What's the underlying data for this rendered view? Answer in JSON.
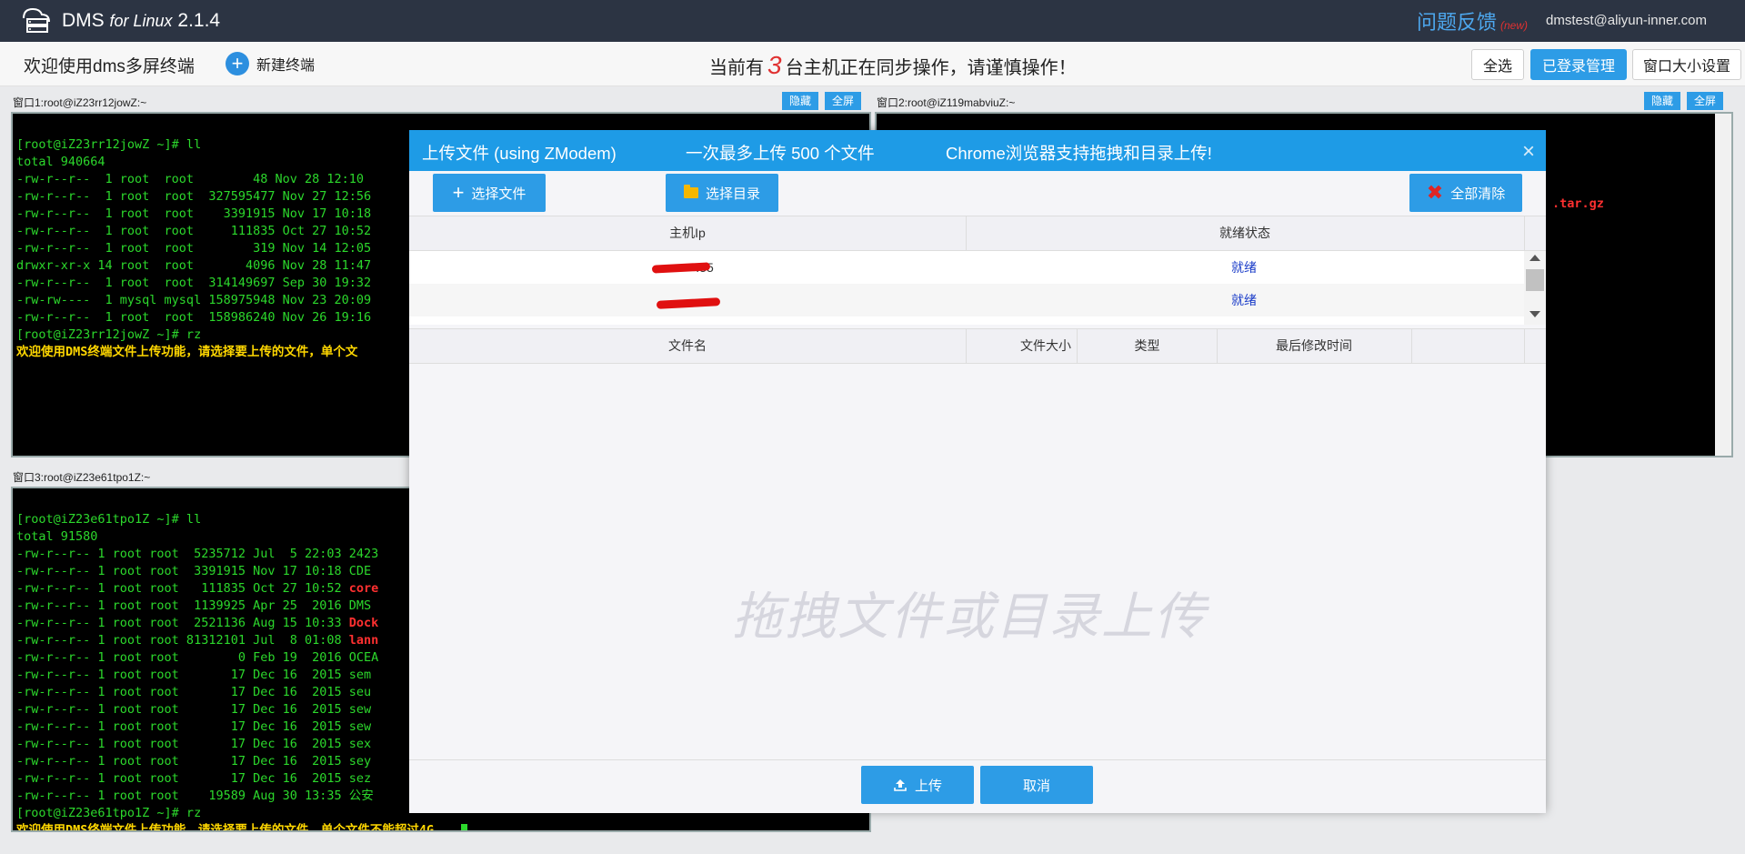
{
  "topbar": {
    "brand_name": "DMS",
    "brand_suffix": "for Linux",
    "version": "2.1.4",
    "feedback_label": "问题反馈",
    "feedback_badge": "(new)",
    "user_email": "dmstest@aliyun-inner.com"
  },
  "subbar": {
    "welcome": "欢迎使用dms多屏终端",
    "new_terminal": "新建终端",
    "sync_prefix": "当前有",
    "sync_count": "3",
    "sync_suffix": "台主机正在同步操作，请谨慎操作！",
    "select_all": "全选",
    "logged_in_mgmt": "已登录管理",
    "window_size_settings": "窗口大小设置"
  },
  "panes": [
    {
      "title": "窗口1:root@iZ23rr12jowZ:~",
      "hide": "隐藏",
      "fullscreen": "全屏",
      "lines": [
        "[root@iZ23rr12jowZ ~]# ll",
        "total 940664",
        "-rw-r--r--  1 root  root        48 Nov 28 12:10",
        "-rw-r--r--  1 root  root  327595477 Nov 27 12:56",
        "-rw-r--r--  1 root  root    3391915 Nov 17 10:18",
        "-rw-r--r--  1 root  root     111835 Oct 27 10:52",
        "-rw-r--r--  1 root  root        319 Nov 14 12:05",
        "drwxr-xr-x 14 root  root       4096 Nov 28 11:47",
        "-rw-r--r--  1 root  root  314149697 Sep 30 19:32",
        "-rw-rw----  1 mysql mysql 158975948 Nov 23 20:09",
        "-rw-r--r--  1 root  root  158986240 Nov 26 19:16",
        "[root@iZ23rr12jowZ ~]# rz",
        "欢迎使用DMS终端文件上传功能，请选择要上传的文件，单个文"
      ]
    },
    {
      "title": "窗口2:root@iZ119mabviuZ:~",
      "hide": "隐藏",
      "fullscreen": "全屏",
      "visible_fragment": ".tar.gz"
    },
    {
      "title": "窗口3:root@iZ23e61tpo1Z:~",
      "lines": [
        "[root@iZ23e61tpo1Z ~]# ll",
        "total 91580",
        "-rw-r--r-- 1 root root  5235712 Jul  5 22:03 2423",
        "-rw-r--r-- 1 root root  3391915 Nov 17 10:18 CDE",
        "-rw-r--r-- 1 root root   111835 Oct 27 10:52 ",
        "-rw-r--r-- 1 root root  1139925 Apr 25  2016 DMS",
        "-rw-r--r-- 1 root root  2521136 Aug 15 10:33 ",
        "-rw-r--r-- 1 root root 81312101 Jul  8 01:08 ",
        "-rw-r--r-- 1 root root        0 Feb 19  2016 OCEA",
        "-rw-r--r-- 1 root root       17 Dec 16  2015 sem",
        "-rw-r--r-- 1 root root       17 Dec 16  2015 seu",
        "-rw-r--r-- 1 root root       17 Dec 16  2015 sew",
        "-rw-r--r-- 1 root root       17 Dec 16  2015 sew",
        "-rw-r--r-- 1 root root       17 Dec 16  2015 sex",
        "-rw-r--r-- 1 root root       17 Dec 16  2015 sey",
        "-rw-r--r-- 1 root root       17 Dec 16  2015 sez",
        "-rw-r--r-- 1 root root    19589 Aug 30 13:35 公安",
        "[root@iZ23e61tpo1Z ~]# rz",
        "欢迎使用DMS终端文件上传功能，请选择要上传的文件，单个文件不能超过4G。"
      ],
      "red_fragments": [
        "core",
        "Dock",
        "lann"
      ]
    }
  ],
  "upload_dialog": {
    "title": "上传文件 (using ZModem)",
    "max_files": "一次最多上传 500 个文件",
    "chrome_hint": "Chrome浏览器支持拖拽和目录上传!",
    "close": "×",
    "select_file": "选择文件",
    "select_dir": "选择目录",
    "clear_all": "全部清除",
    "host_columns": [
      "主机Ip",
      "就绪状态"
    ],
    "hosts": [
      {
        "ip": ".35",
        "status": "就绪"
      },
      {
        "ip": "",
        "status": "就绪"
      }
    ],
    "file_columns": [
      "文件名",
      "文件大小",
      "类型",
      "最后修改时间"
    ],
    "drop_hint": "拖拽文件或目录上传",
    "upload": "上传",
    "cancel": "取消"
  }
}
